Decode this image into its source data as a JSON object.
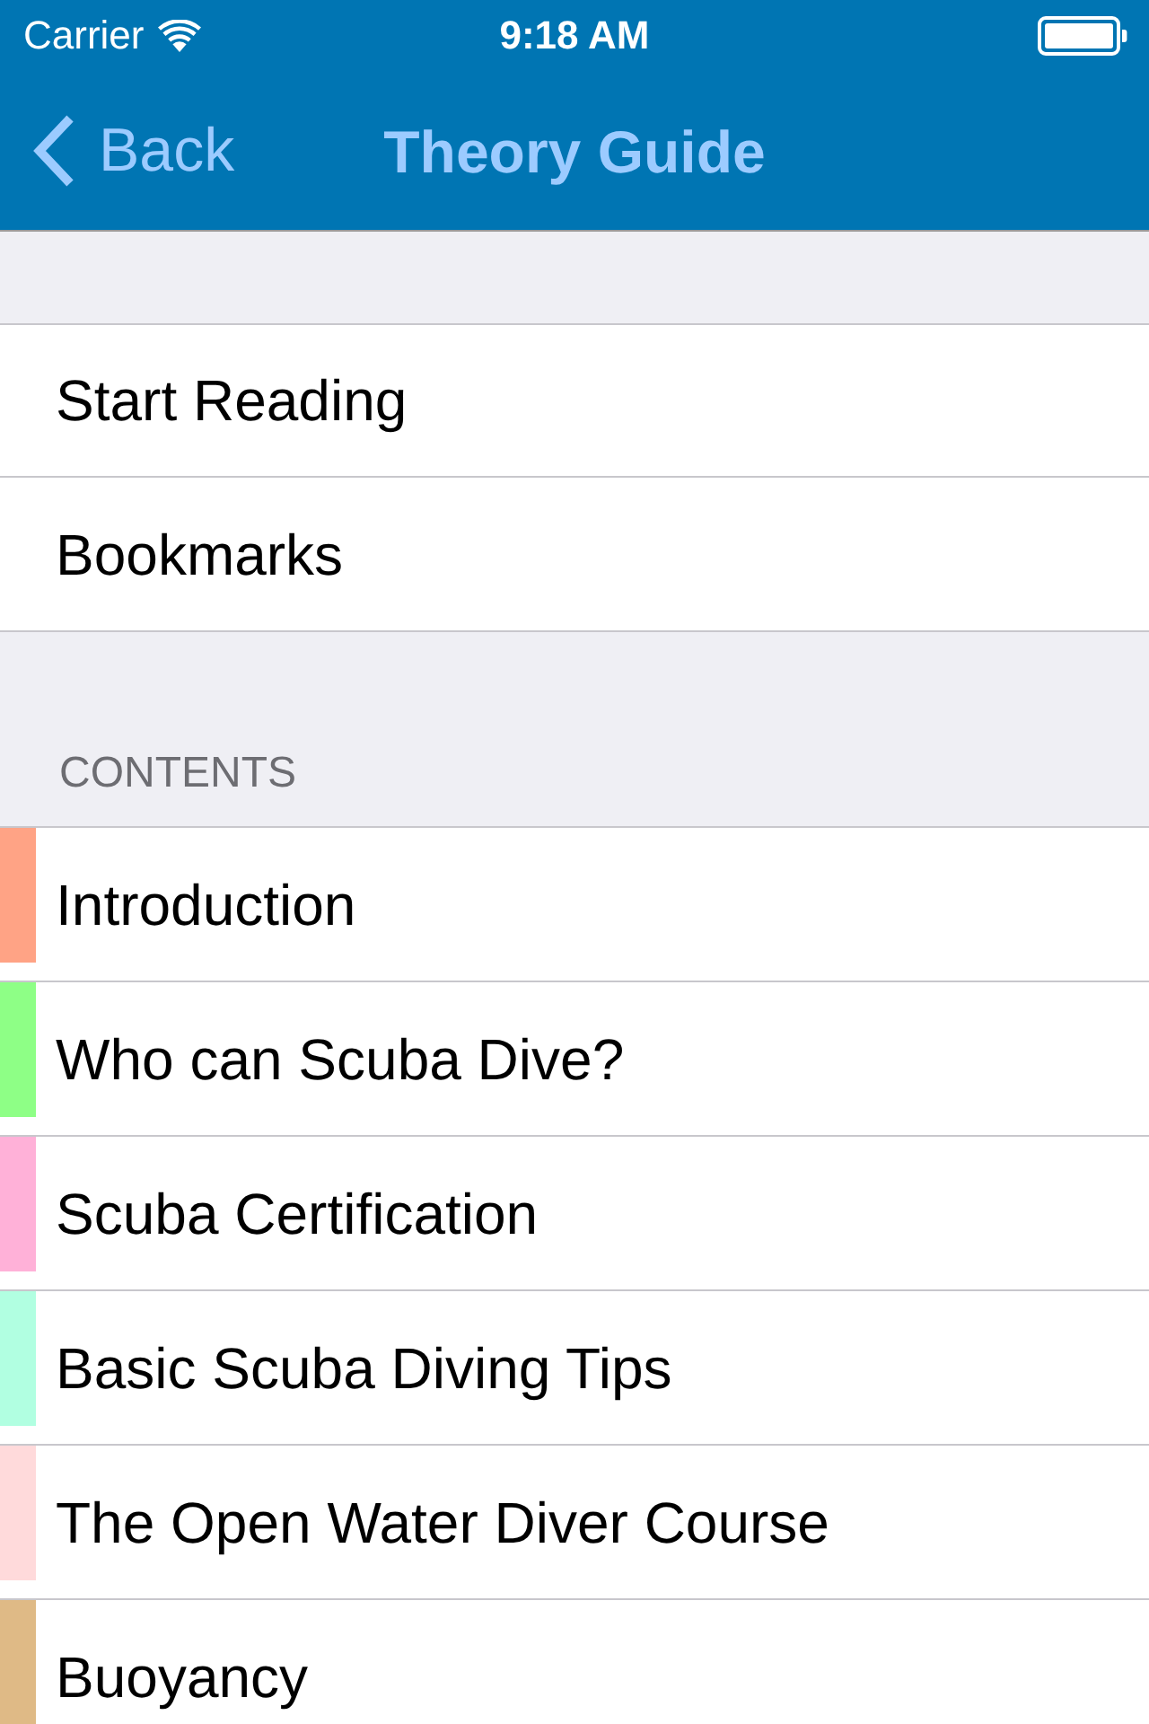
{
  "status_bar": {
    "carrier": "Carrier",
    "time": "9:18 AM"
  },
  "nav_bar": {
    "back": "Back",
    "title": "Theory Guide"
  },
  "menu": [
    {
      "label": "Start Reading"
    },
    {
      "label": "Bookmarks"
    }
  ],
  "contents": {
    "header": "CONTENTS",
    "items": [
      {
        "label": "Introduction",
        "color": "#ffa385"
      },
      {
        "label": "Who can Scuba Dive?",
        "color": "#8eff86"
      },
      {
        "label": "Scuba Certification",
        "color": "#ffb1d8"
      },
      {
        "label": "Basic Scuba Diving Tips",
        "color": "#b1ffe1"
      },
      {
        "label": "The Open Water Diver Course",
        "color": "#ffdadb"
      },
      {
        "label": "Buoyancy",
        "color": "#dfba86"
      }
    ]
  }
}
